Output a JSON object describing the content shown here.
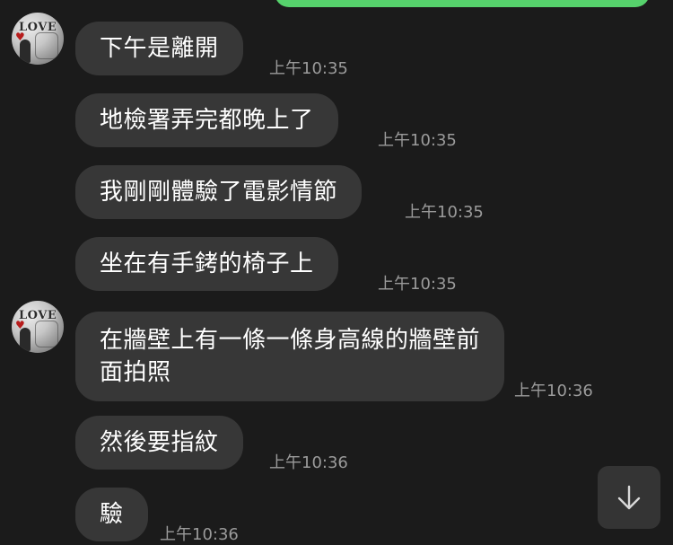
{
  "avatar": {
    "icon": "avatar-love-icon",
    "text": "LOVE"
  },
  "messages": [
    {
      "text": "下午是離開",
      "time": "上午10:35"
    },
    {
      "text": "地檢署弄完都晚上了",
      "time": "上午10:35"
    },
    {
      "text": "我剛剛體驗了電影情節",
      "time": "上午10:35"
    },
    {
      "text": "坐在有手銬的椅子上",
      "time": "上午10:35"
    },
    {
      "text": "在牆壁上有一條一條身高線的牆壁前面拍照",
      "time": "上午10:36"
    },
    {
      "text": "然後要指紋",
      "time": "上午10:36"
    },
    {
      "text": "驗",
      "time": "上午10:36"
    }
  ],
  "colors": {
    "background": "#1b1b1b",
    "bubble": "#373737",
    "sent_bubble": "#56d26c",
    "timestamp": "#9b9b9b",
    "text": "#ffffff"
  },
  "scroll_button": {
    "icon": "arrow-down-icon"
  }
}
